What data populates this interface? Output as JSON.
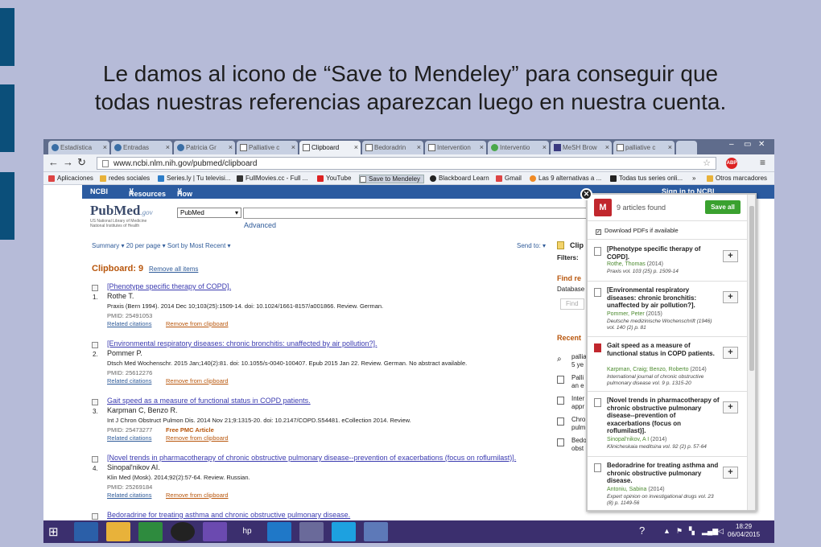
{
  "slide": {
    "line1": "Le damos al icono de “Save to Mendeley” para conseguir que",
    "line2": "todas nuestras referencias aparezcan luego en nuestra cuenta."
  },
  "browser": {
    "tabs": [
      "Estadística",
      "Entradas",
      "Patricia Gr",
      "Palliative c",
      "Clipboard",
      "Bedoradrin",
      "Intervention",
      "Interventio",
      "MeSH Brow",
      "palliative c"
    ],
    "active_tab_index": 4,
    "url": "www.ncbi.nlm.nih.gov/pubmed/clipboard",
    "bookmarks": [
      "Aplicaciones",
      "redes sociales",
      "Series.ly | Tu televisi...",
      "FullMovies.cc - Full ...",
      "YouTube",
      "Save to Mendeley",
      "Blackboard Learn",
      "Gmail",
      "Las 9 alternativas a ...",
      "Todas tus series onli...",
      "»",
      "Otros marcadores"
    ]
  },
  "ncbi": {
    "brand": "NCBI",
    "resources": "Resources",
    "howto": "How To",
    "signin": "Sign in to NCBI"
  },
  "pubmed": {
    "logo": "PubMed",
    "logo_suffix": ".gov",
    "sub1": "US National Library of Medicine",
    "sub2": "National Institutes of Health",
    "db": "PubMed",
    "advanced": "Advanced",
    "display": "Summary ▾   20 per page ▾   Sort by Most Recent ▾",
    "sendto": "Send to: ▾",
    "clipboard_title": "Clipboard: 9",
    "remove_all": "Remove all items",
    "related": "Related citations",
    "remove": "Remove from clipboard",
    "results": [
      {
        "num": "1.",
        "title": "[Phenotype specific therapy of COPD].",
        "authors": "Rothe T.",
        "source": "Praxis (Bern 1994). 2014 Dec 10;103(25):1509-14. doi: 10.1024/1661-8157/a001866. Review. German.",
        "pmid": "PMID: 25491053",
        "free": ""
      },
      {
        "num": "2.",
        "title": "[Environmental respiratory diseases: chronic bronchitis: unaffected by air pollution?].",
        "authors": "Pommer P.",
        "source": "Dtsch Med Wochenschr. 2015 Jan;140(2):81. doi: 10.1055/s-0040-100407. Epub 2015 Jan 22. Review. German. No abstract available.",
        "pmid": "PMID: 25612276",
        "free": ""
      },
      {
        "num": "3.",
        "title": "Gait speed as a measure of functional status in COPD patients.",
        "authors": "Karpman C, Benzo R.",
        "source": "Int J Chron Obstruct Pulmon Dis. 2014 Nov 21;9:1315-20. doi: 10.2147/COPD.S54481. eCollection 2014. Review.",
        "pmid": "PMID: 25473277",
        "free": "Free PMC Article"
      },
      {
        "num": "4.",
        "title": "[Novel trends in pharmacotherapy of chronic obstructive pulmonary disease--prevention of exacerbations (focus on roflumilast)].",
        "authors": "Sinopal'nikov AI.",
        "source": "Klin Med (Mosk). 2014;92(2):57-64. Review. Russian.",
        "pmid": "PMID: 25269184",
        "free": ""
      },
      {
        "num": "5.",
        "title": "Bedoradrine for treating asthma and chronic obstructive pulmonary disease.",
        "authors": "",
        "source": "",
        "pmid": "",
        "free": ""
      }
    ],
    "right_col": {
      "clip": "Clip",
      "filters": "Filters:",
      "find": "Find re",
      "database": "Database",
      "find_btn": "Find",
      "recent": "Recent",
      "items": [
        "pallia\n5 ye",
        "Palli\nan e",
        "Inter\nappr",
        "Chro\npulm",
        "Bedo\nobst"
      ]
    }
  },
  "mendeley": {
    "count": "9 articles found",
    "save_all": "Save all",
    "download_pdfs": "Download PDFs if available",
    "articles": [
      {
        "title": "[Phenotype specific therapy of COPD].",
        "author": "Rothe, Thomas",
        "year": "(2014)",
        "journal": "Praxis vol. 103 (25) p. 1509-14",
        "pdf": false
      },
      {
        "title": "[Environmental respiratory diseases: chronic bronchitis: unaffected by air pollution?].",
        "author": "Pommer, Peter",
        "year": "(2015)",
        "journal": "Deutsche medizinische Wochenschrift (1946) vol. 140 (2) p. 81",
        "pdf": false
      },
      {
        "title": "Gait speed as a measure of functional status in COPD patients.",
        "author": "Karpman, Craig;  Benzo, Roberto",
        "year": "(2014)",
        "journal": "International journal of chronic obstructive pulmonary disease vol. 9 p. 1315-20",
        "pdf": true
      },
      {
        "title": "[Novel trends in pharmacotherapy of chronic obstructive pulmonary disease--prevention of exacerbations (focus on roflumilast)].",
        "author": "Sinopal'nikov, A I",
        "year": "(2014)",
        "journal": "Klinicheskaia meditsina vol. 92 (2) p. 57-64",
        "pdf": false
      },
      {
        "title": "Bedoradrine for treating asthma and chronic obstructive pulmonary disease.",
        "author": "Antoniu, Sabina",
        "year": "(2014)",
        "journal": "Expert opinion on investigational drugs vol. 23 (8) p. 1149-56",
        "pdf": false
      }
    ]
  },
  "taskbar": {
    "time": "18:29",
    "date": "06/04/2015"
  },
  "colors": {
    "slide_bg": "#b6bbd8",
    "ncbi_blue": "#2b5ba0",
    "mendeley_red": "#c1272d",
    "save_green": "#3aa12f",
    "taskbar": "#3b2f6e"
  }
}
